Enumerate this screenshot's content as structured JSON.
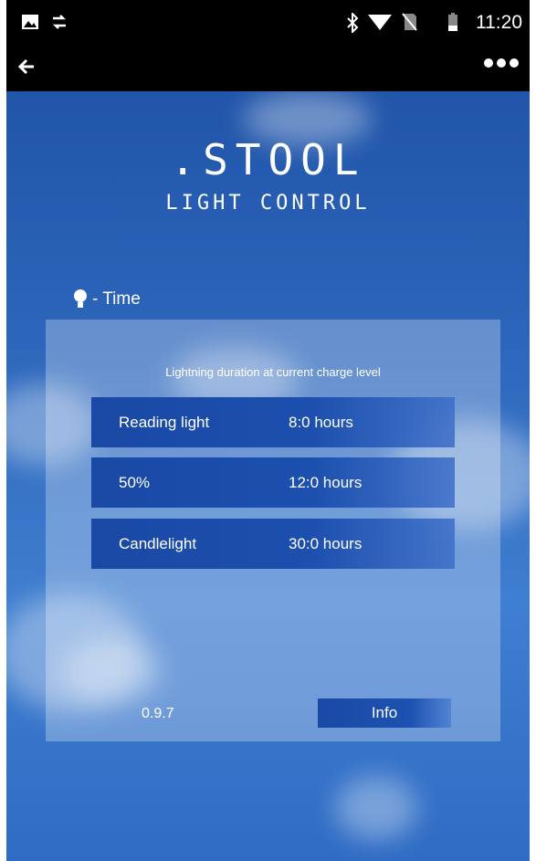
{
  "status_bar": {
    "time": "11:20",
    "left_icons": [
      "image-icon",
      "sync-icon"
    ],
    "right_icons": [
      "bluetooth-icon",
      "wifi-icon",
      "no-sim-icon",
      "battery-icon"
    ]
  },
  "app_bar": {
    "back_icon": "back-arrow-icon",
    "menu_icon": "more-dots-icon"
  },
  "logo": {
    "main": ".STOOL",
    "sub": "LIGHT CONTROL"
  },
  "section": {
    "label": "- Time",
    "icon": "bulb-icon"
  },
  "panel": {
    "title": "Lightning duration at current charge level",
    "rows": [
      {
        "name": "Reading light",
        "value": "8:0 hours"
      },
      {
        "name": "50%",
        "value": "12:0 hours"
      },
      {
        "name": "Candlelight",
        "value": "30:0 hours"
      }
    ],
    "version": "0.9.7",
    "info_label": "Info"
  },
  "colors": {
    "bar_bg": "#000000",
    "row_bg": "#1a49a5",
    "sky": "#2a63b8"
  }
}
